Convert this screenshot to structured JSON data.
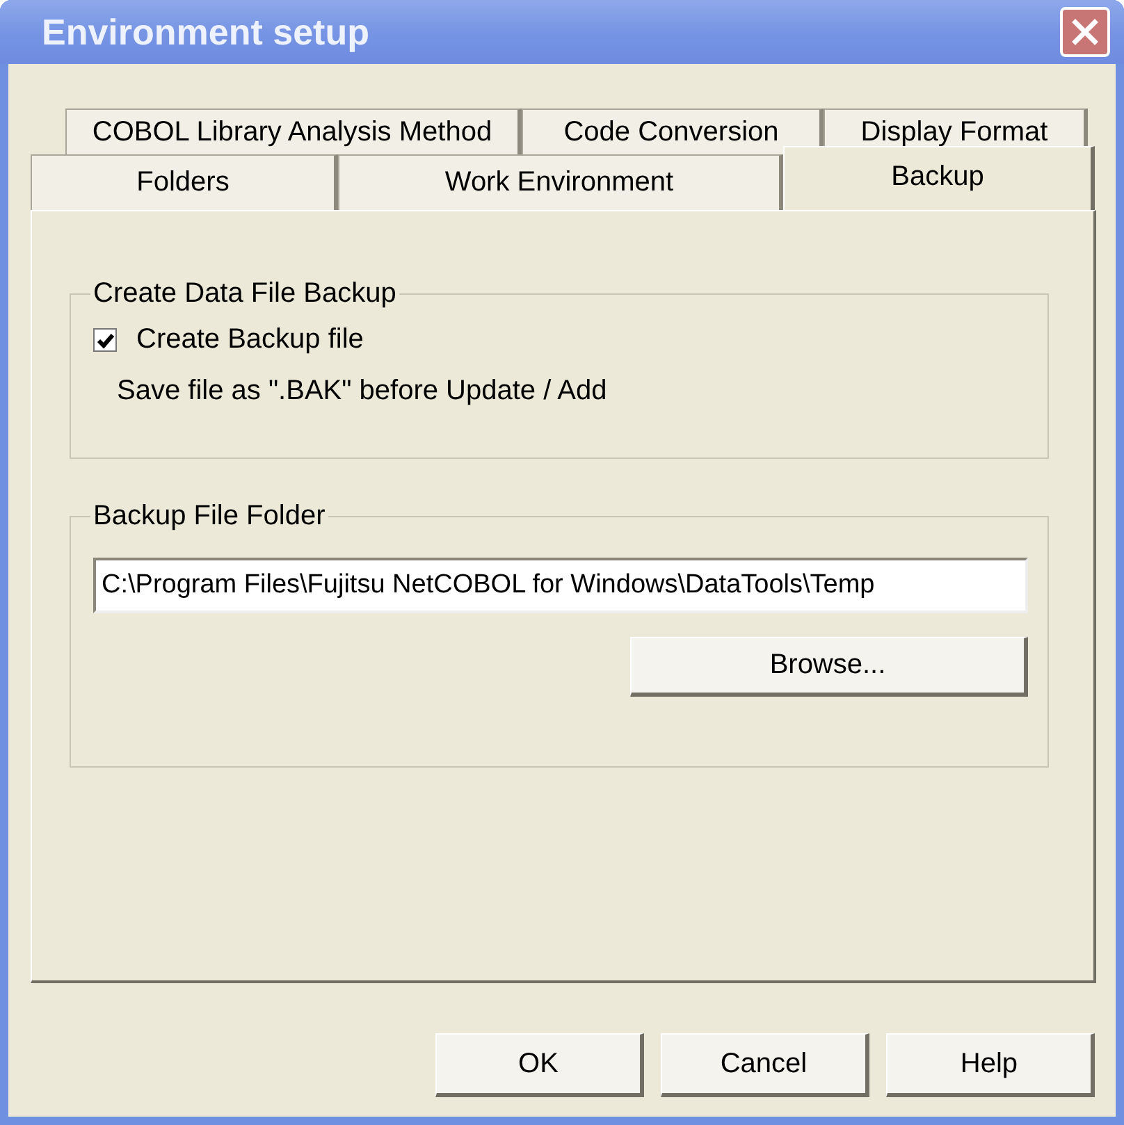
{
  "window": {
    "title": "Environment setup"
  },
  "tab_rows": [
    {
      "tabs": [
        {
          "label": "COBOL Library Analysis Method",
          "selected": false
        },
        {
          "label": "Code Conversion",
          "selected": false
        },
        {
          "label": "Display Format",
          "selected": false
        }
      ]
    },
    {
      "tabs": [
        {
          "label": "Folders",
          "selected": false
        },
        {
          "label": "Work Environment",
          "selected": false
        },
        {
          "label": "Backup",
          "selected": true
        }
      ]
    }
  ],
  "backup_group": {
    "title": "Create Data File Backup",
    "checkbox": {
      "label": "Create Backup file",
      "checked": true
    },
    "note": "Save file as \".BAK\" before Update / Add"
  },
  "folder_group": {
    "title": "Backup File Folder",
    "path": "C:\\Program Files\\Fujitsu NetCOBOL for Windows\\DataTools\\Temp",
    "browse_button": "Browse..."
  },
  "buttons": [
    "OK",
    "Cancel",
    "Help"
  ]
}
